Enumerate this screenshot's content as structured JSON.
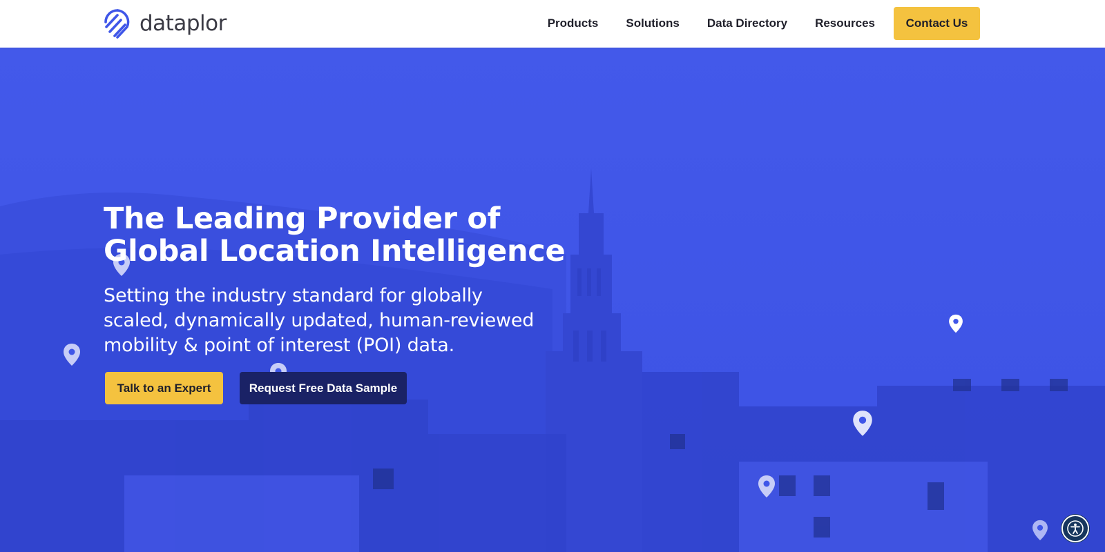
{
  "brand": {
    "name": "dataplor",
    "accent": "#f4c23f",
    "primary": "#3f56e8",
    "dark": "#1a2266"
  },
  "nav": {
    "items": [
      {
        "label": "Products"
      },
      {
        "label": "Solutions"
      },
      {
        "label": "Data Directory"
      },
      {
        "label": "Resources"
      }
    ],
    "cta": "Contact Us"
  },
  "hero": {
    "title": "The Leading Provider of Global Location Intelligence",
    "subtitle": "Setting the industry standard for globally scaled, dynamically updated, human-reviewed mobility & point of interest (POI) data.",
    "primary_cta": "Talk to an Expert",
    "secondary_cta": "Request Free Data Sample"
  },
  "icons": {
    "map_pin": "map-pin-icon",
    "accessibility": "accessibility-icon",
    "logo": "dataplor-logo-icon"
  }
}
